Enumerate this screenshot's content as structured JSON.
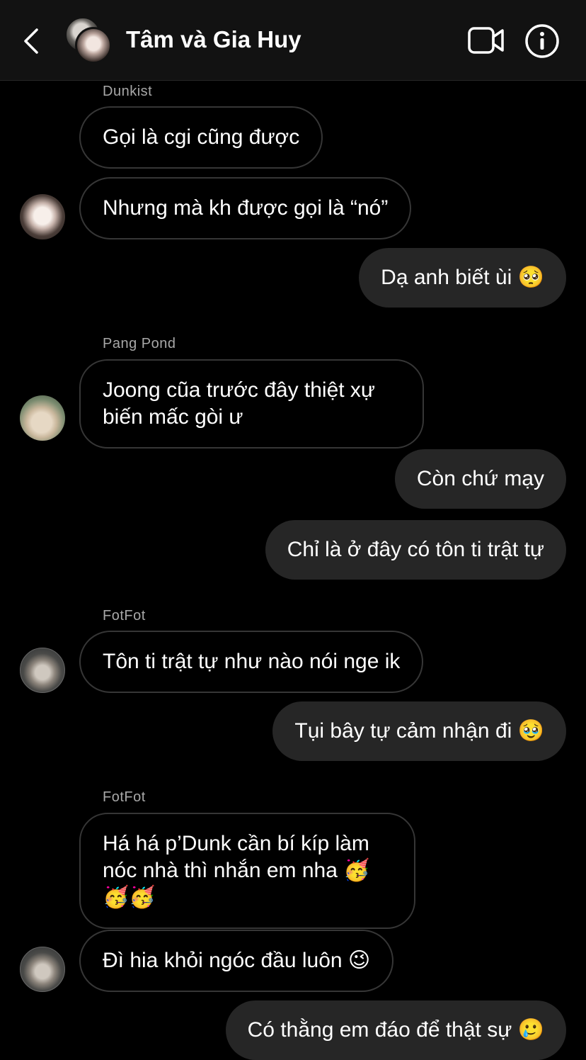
{
  "header": {
    "title": "Tâm và Gia Huy",
    "back_icon": "chevron-left-icon",
    "video_icon": "video-camera-icon",
    "info_icon": "info-icon"
  },
  "messages": [
    {
      "sender": "Dunkist",
      "text": "Gọi là cgi cũng được",
      "direction": "incoming"
    },
    {
      "text": "Nhưng mà kh được gọi là “nó”",
      "direction": "incoming"
    },
    {
      "text": "Dạ anh biết ùi",
      "emoji": "🥺",
      "direction": "outgoing"
    },
    {
      "sender": "Pang Pond",
      "line1": "Joong cũa trước đây thiệt xự",
      "line2": "biến mấc gòi ư",
      "direction": "incoming"
    },
    {
      "text": "Còn chứ mạy",
      "direction": "outgoing"
    },
    {
      "text": "Chỉ là ở đây có tôn ti trật tự",
      "direction": "outgoing"
    },
    {
      "sender": "FotFot",
      "text": "Tôn ti trật tự như nào nói nge ik",
      "direction": "incoming"
    },
    {
      "text": "Tụi bây tự cảm nhận đi",
      "emoji": "🥹",
      "direction": "outgoing"
    },
    {
      "sender": "FotFot",
      "line1": "Há há p’Dunk cần bí kíp làm",
      "line2": "nóc nhà thì nhắn em nha",
      "emoji_inline": "🥳",
      "emoji_line3": "🥳🥳",
      "direction": "incoming"
    },
    {
      "text": "Đì hia khỏi ngóc đầu luôn",
      "emoji": "😉",
      "direction": "incoming"
    },
    {
      "text": "Có thằng em đáo để thật sự",
      "emoji": "🥲",
      "direction": "outgoing"
    }
  ]
}
